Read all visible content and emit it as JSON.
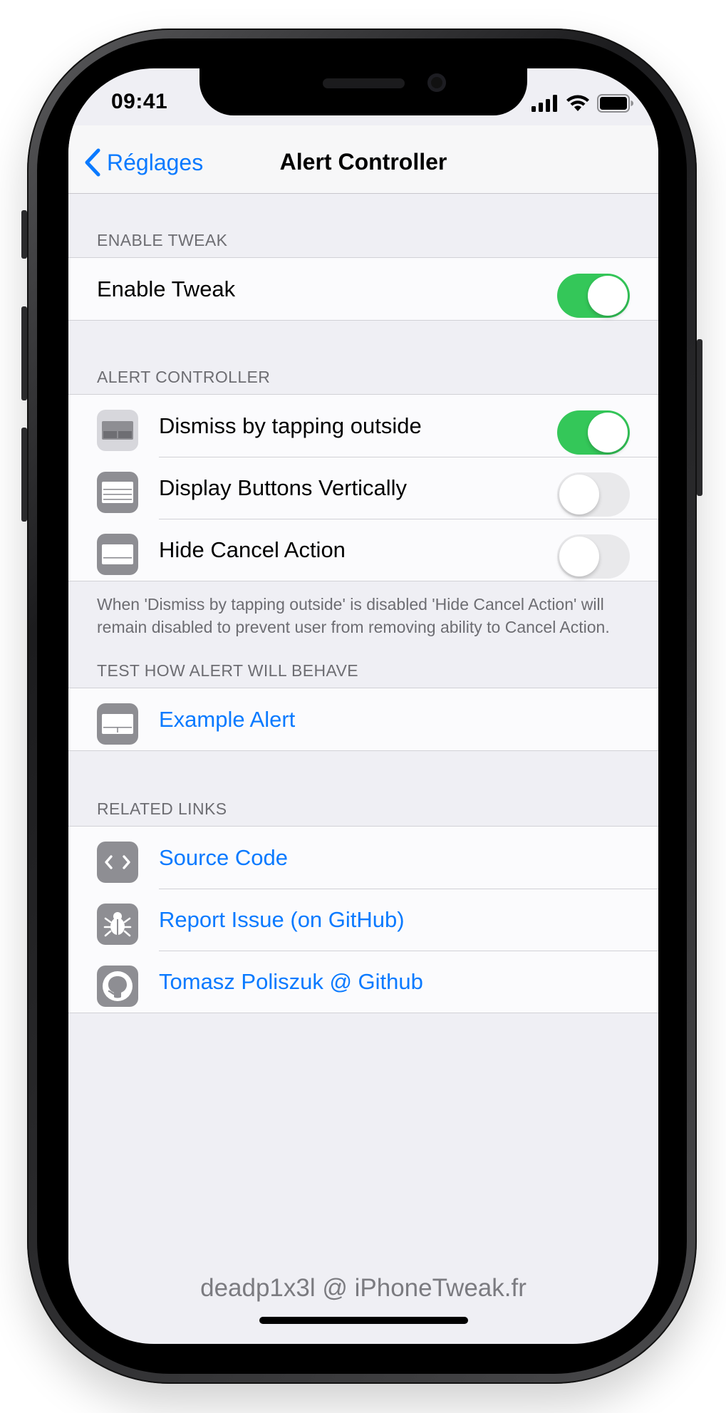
{
  "status_bar": {
    "time": "09:41"
  },
  "nav": {
    "back_label": "Réglages",
    "title": "Alert Controller"
  },
  "sections": {
    "enable": {
      "header": "ENABLE TWEAK",
      "row_label": "Enable Tweak",
      "toggle_on": true
    },
    "alert_controller": {
      "header": "ALERT CONTROLLER",
      "rows": [
        {
          "label": "Dismiss by tapping outside",
          "toggle_on": true,
          "icon": "alert-dismiss-icon"
        },
        {
          "label": "Display Buttons Vertically",
          "toggle_on": false,
          "icon": "alert-vertical-buttons-icon"
        },
        {
          "label": "Hide Cancel Action",
          "toggle_on": false,
          "icon": "alert-hide-cancel-icon"
        }
      ],
      "footer": "When 'Dismiss by tapping outside' is disabled 'Hide Cancel Action' will remain disabled to prevent user from removing ability to Cancel Action."
    },
    "test": {
      "header": "TEST HOW ALERT WILL BEHAVE",
      "row_label": "Example Alert",
      "icon": "alert-example-icon"
    },
    "related": {
      "header": "RELATED LINKS",
      "rows": [
        {
          "label": "Source Code",
          "icon": "code-icon"
        },
        {
          "label": "Report Issue (on GitHub)",
          "icon": "bug-icon"
        },
        {
          "label": "Tomasz Poliszuk @ Github",
          "icon": "github-icon"
        }
      ]
    }
  },
  "credit": "deadp1x3l @ iPhoneTweak.fr",
  "colors": {
    "accent": "#0a7aff",
    "toggle_on": "#34c759",
    "background": "#efeff4"
  }
}
